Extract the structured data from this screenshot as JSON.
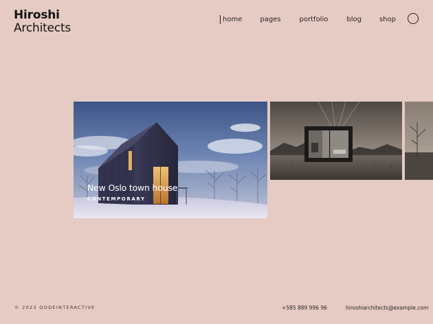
{
  "brand": {
    "line1": "Hiroshi",
    "line2": "Architects"
  },
  "nav": {
    "items": [
      "home",
      "pages",
      "portfolio",
      "blog",
      "shop"
    ],
    "active": "home"
  },
  "menu_icon": "circle-menu-icon",
  "slider": {
    "slides": [
      {
        "title": "New Oslo town house",
        "category": "CONTEMPORARY",
        "image": "dark-wooden-house-at-dusk"
      },
      {
        "image": "glass-cabin-in-field-sepia"
      },
      {
        "image": "sepia-landscape-partial"
      }
    ]
  },
  "footer": {
    "copyright": "© 2023 QODEINTERACTIVE",
    "phone": "+585 889 996 96",
    "email": "hiroshiarchitects@example.com"
  }
}
